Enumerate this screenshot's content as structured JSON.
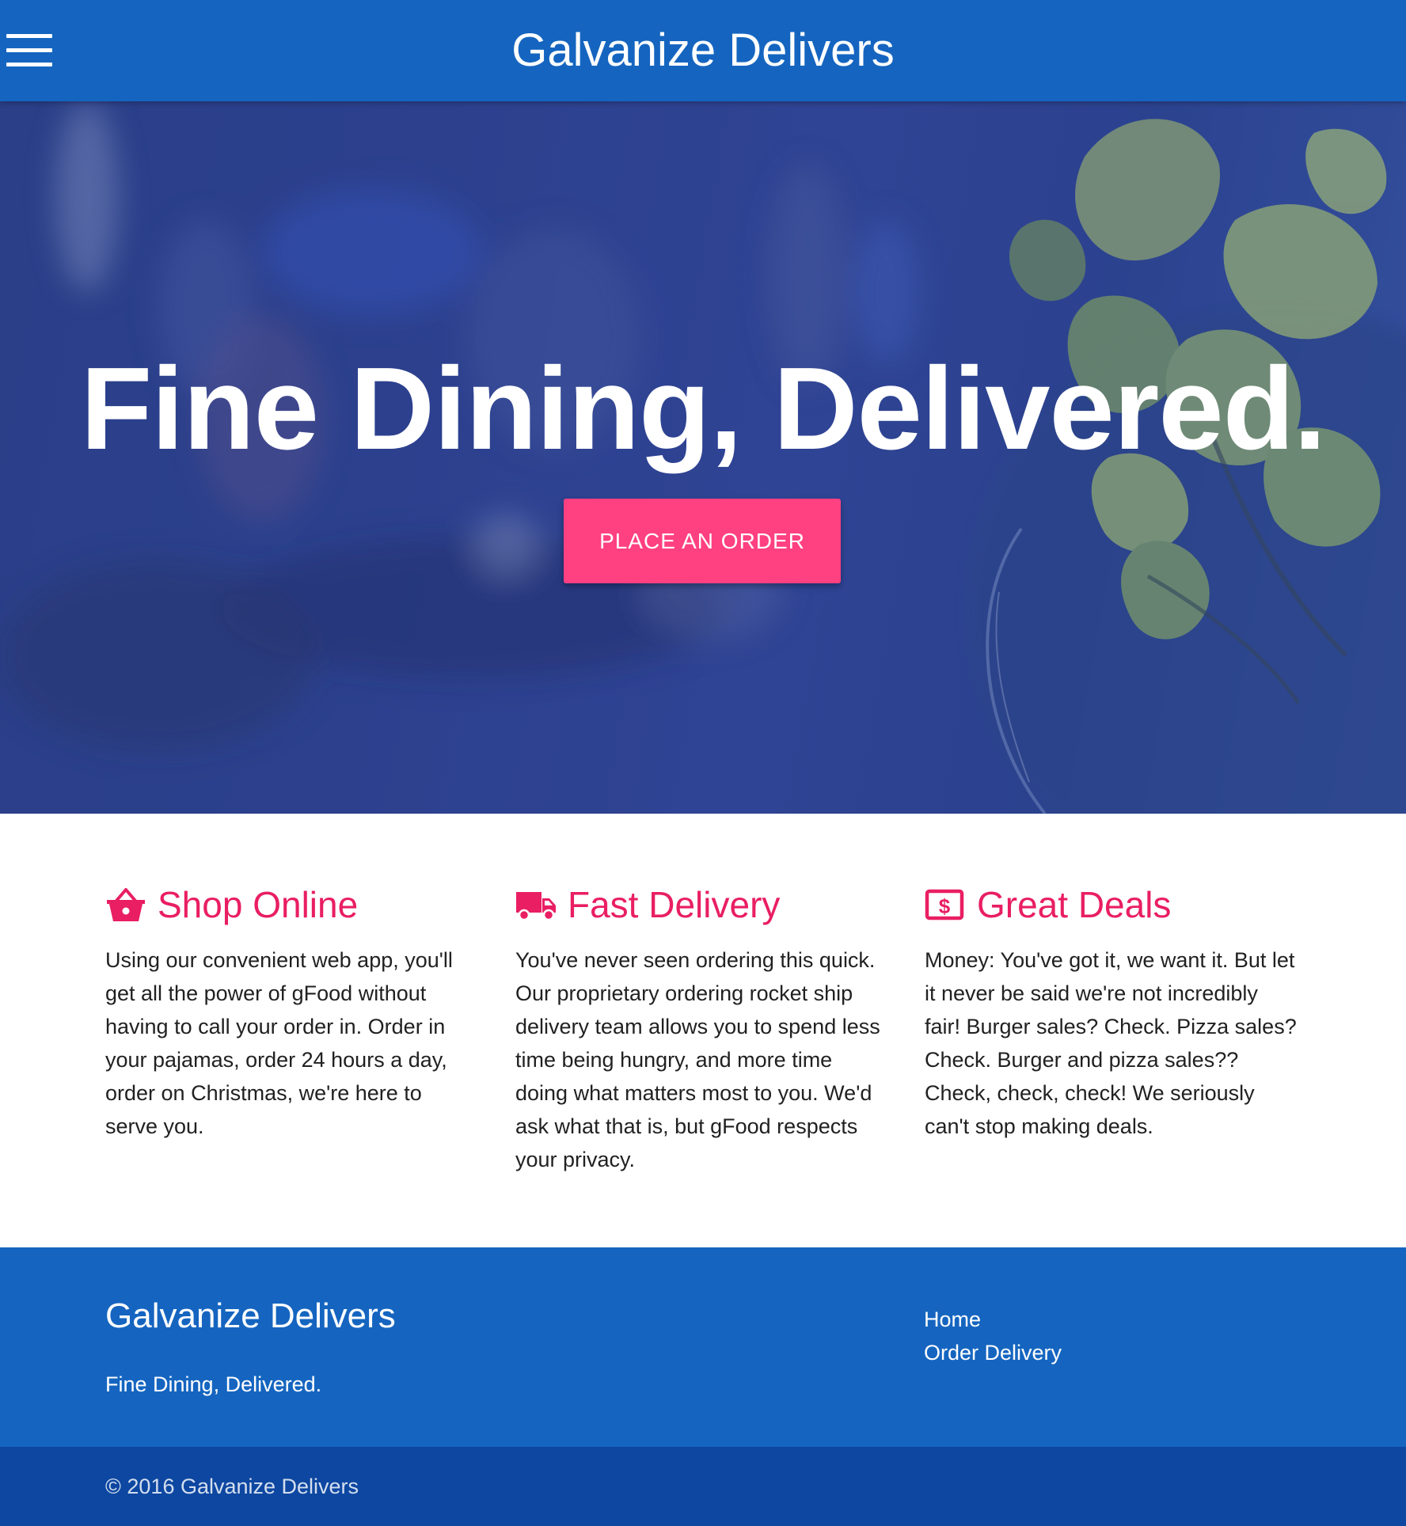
{
  "header": {
    "brand": "Galvanize Delivers",
    "menu_icon": "hamburger-menu-icon"
  },
  "hero": {
    "title": "Fine Dining, Delivered.",
    "cta_label": "PLACE AN ORDER"
  },
  "features": [
    {
      "icon": "shopping-basket-icon",
      "title": "Shop Online",
      "body": "Using our convenient web app, you'll get all the power of gFood without having to call your order in. Order in your pajamas, order 24 hours a day, order on Christmas, we're here to serve you."
    },
    {
      "icon": "delivery-truck-icon",
      "title": "Fast Delivery",
      "body": "You've never seen ordering this quick. Our proprietary ordering rocket ship delivery team allows you to spend less time being hungry, and more time doing what matters most to you. We'd ask what that is, but gFood respects your privacy."
    },
    {
      "icon": "dollar-bill-icon",
      "title": "Great Deals",
      "body": "Money: You've got it, we want it. But let it never be said we're not incredibly fair! Burger sales? Check. Pizza sales? Check. Burger and pizza sales?? Check, check, check! We seriously can't stop making deals."
    }
  ],
  "footer": {
    "title": "Galvanize Delivers",
    "tagline": "Fine Dining, Delivered.",
    "links": [
      "Home",
      "Order Delivery"
    ],
    "copyright": "© 2016 Galvanize Delivers"
  },
  "colors": {
    "primary": "#1565c0",
    "primary_dark": "#0d47a1",
    "accent": "#ff4081",
    "feature_title": "#e91e63"
  }
}
